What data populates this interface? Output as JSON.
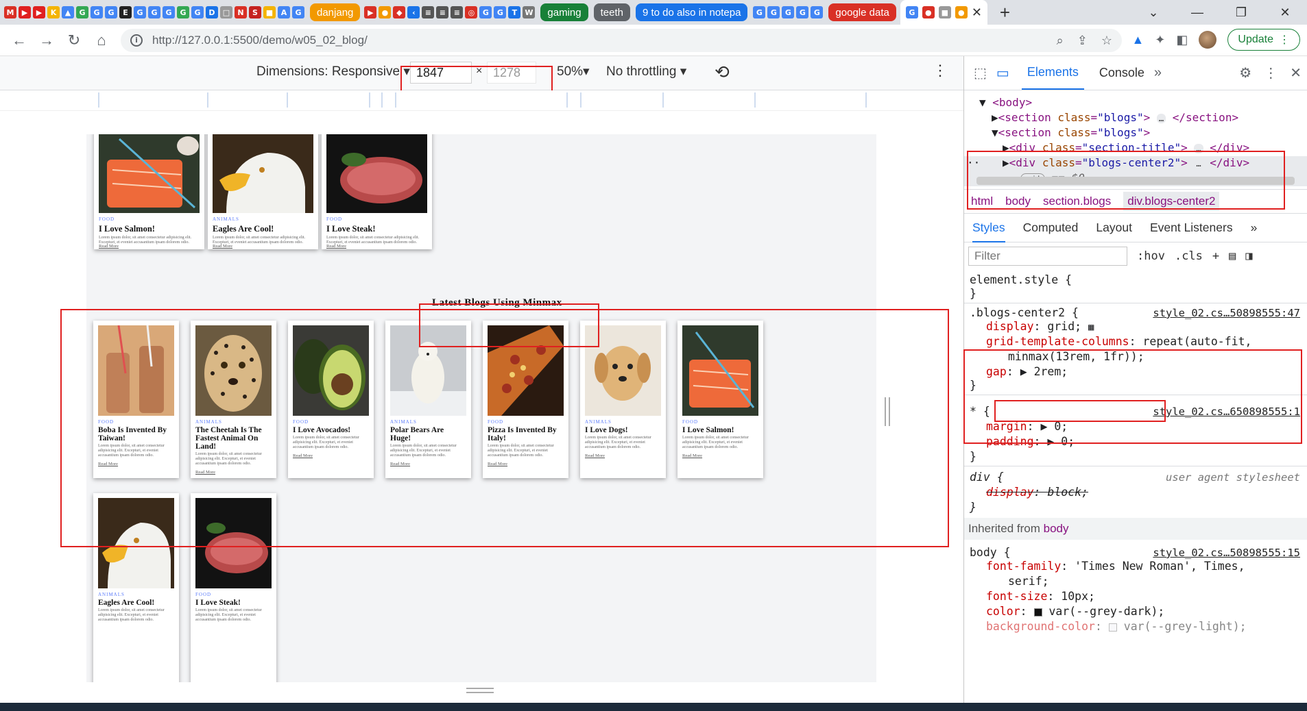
{
  "browser": {
    "bookmark_groups": [
      "danjang",
      "gaming",
      "teeth",
      "9 to do also in notepa",
      "google data"
    ],
    "url": "http://127.0.0.1:5500/demo/w05_02_blog/",
    "update_label": "Update"
  },
  "device_toolbar": {
    "dimensions_label": "Dimensions: Responsive",
    "width": "1847",
    "times": "×",
    "height": "1278",
    "zoom": "50%",
    "throttling": "No throttling"
  },
  "page": {
    "section_title": "Latest Blogs Using Minmax",
    "lorem": "Lorem ipsum dolor, sit amet consectetur adipisicing elit. Excepturi, et eveniet accusantium ipsam dolorem odio.",
    "read_more": "Read More",
    "top_cards": [
      {
        "category": "FOOD",
        "title": "I Love Salmon!"
      },
      {
        "category": "ANIMALS",
        "title": "Eagles Are Cool!"
      },
      {
        "category": "FOOD",
        "title": "I Love Steak!"
      }
    ],
    "minmax_cards": [
      {
        "category": "FOOD",
        "title": "Boba Is Invented By Taiwan!"
      },
      {
        "category": "ANIMALS",
        "title": "The Cheetah Is The Fastest Animal On Land!"
      },
      {
        "category": "FOOD",
        "title": "I Love Avocados!"
      },
      {
        "category": "ANIMALS",
        "title": "Polar Bears Are Huge!"
      },
      {
        "category": "FOOD",
        "title": "Pizza Is Invented By Italy!"
      },
      {
        "category": "ANIMALS",
        "title": "I Love Dogs!"
      },
      {
        "category": "FOOD",
        "title": "I Love Salmon!"
      }
    ],
    "bottom_cards": [
      {
        "category": "ANIMALS",
        "title": "Eagles Are Cool!"
      },
      {
        "category": "FOOD",
        "title": "I Love Steak!"
      }
    ]
  },
  "devtools": {
    "tabs": [
      "Elements",
      "Console"
    ],
    "dom": {
      "body_tag": "<body>",
      "section1_open": "<section",
      "section1_attr": "class",
      "section1_val": "\"blogs\"",
      "section1_close": "</section>",
      "section2_open": "<section",
      "section2_attr": "class",
      "section2_val": "\"blogs\"",
      "div1_open": "<div",
      "div1_attr": "class",
      "div1_val": "\"section-title\"",
      "div1_close": "</div>",
      "div2_open": "<div",
      "div2_attr": "class",
      "div2_val": "\"blogs-center2\"",
      "div2_close": "</div>",
      "grid_badge": "grid",
      "dollar": "== $0"
    },
    "breadcrumbs": [
      "html",
      "body",
      "section.blogs",
      "div.blogs-center2"
    ],
    "subtabs": [
      "Styles",
      "Computed",
      "Layout",
      "Event Listeners"
    ],
    "filter_placeholder": "Filter",
    "hov": ":hov",
    "cls": ".cls",
    "styles": {
      "element_style": "element.style {",
      "close_brace": "}",
      "rule1_selector": ".blogs-center2 {",
      "rule1_source": "style_02.cs…50898555:47",
      "display_prop": "display",
      "display_val": "grid;",
      "gtc_prop": "grid-template-columns",
      "gtc_val1": "repeat(auto-fit,",
      "gtc_val2": "minmax(13rem, 1fr));",
      "gap_prop": "gap",
      "gap_val": "2rem;",
      "rule2_selector": "* {",
      "rule2_source": "style_02.cs…650898555:1",
      "margin_prop": "margin",
      "margin_val": "0;",
      "padding_prop": "padding",
      "padding_val": "0;",
      "rule3_selector": "div {",
      "rule3_source": "user agent stylesheet",
      "ua_prop": "display",
      "ua_val": "block;",
      "inherited_label": "Inherited from",
      "inherited_from": "body",
      "rule4_selector": "body {",
      "rule4_source": "style_02.cs…50898555:15",
      "ff_prop": "font-family",
      "ff_val1": "'Times New Roman', Times,",
      "ff_val2": "serif;",
      "fs_prop": "font-size",
      "fs_val": "10px;",
      "color_prop": "color",
      "color_val": "var(--grey-dark);",
      "bg_prop": "background-color",
      "bg_val": "var(--grey-light);"
    }
  },
  "colors": {
    "annotation_red": "#e02020",
    "devtools_blue": "#1a73e8",
    "update_green": "#188038"
  }
}
